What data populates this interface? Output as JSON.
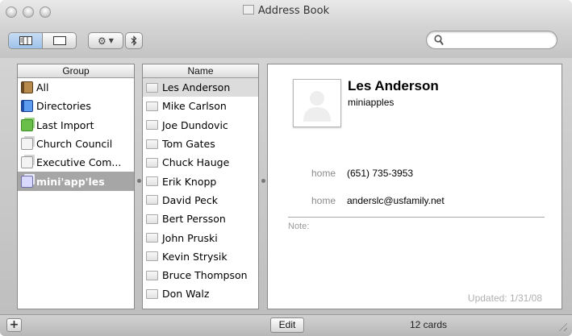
{
  "window": {
    "title": "Address Book"
  },
  "toolbar": {
    "view_buttons": [
      "columns-view",
      "card-only-view"
    ],
    "action_icon": "gear-icon",
    "bluetooth_icon": "bluetooth-icon",
    "search_placeholder": "",
    "search_icon": "magnifier-icon"
  },
  "groups": {
    "header": "Group",
    "items": [
      {
        "label": "All",
        "icon": "address-book-icon",
        "selected": false
      },
      {
        "label": "Directories",
        "icon": "directory-icon",
        "selected": false
      },
      {
        "label": "Last Import",
        "icon": "group-icon",
        "selected": false
      },
      {
        "label": "Church Council",
        "icon": "group-icon",
        "selected": false
      },
      {
        "label": "Executive Com...",
        "icon": "group-icon",
        "selected": false
      },
      {
        "label": "mini'app'les",
        "icon": "smart-group-icon",
        "selected": true
      }
    ]
  },
  "names": {
    "header": "Name",
    "items": [
      {
        "label": "Les Anderson",
        "selected": true
      },
      {
        "label": "Mike Carlson",
        "selected": false
      },
      {
        "label": "Joe Dundovic",
        "selected": false
      },
      {
        "label": "Tom Gates",
        "selected": false
      },
      {
        "label": "Chuck Hauge",
        "selected": false
      },
      {
        "label": "Erik Knopp",
        "selected": false
      },
      {
        "label": "David Peck",
        "selected": false
      },
      {
        "label": "Bert Persson",
        "selected": false
      },
      {
        "label": "John Pruski",
        "selected": false
      },
      {
        "label": "Kevin Strysik",
        "selected": false
      },
      {
        "label": "Bruce Thompson",
        "selected": false
      },
      {
        "label": "Don Walz",
        "selected": false
      }
    ]
  },
  "card": {
    "name": "Les Anderson",
    "company": "miniapples",
    "fields": [
      {
        "label": "home",
        "value": "(651) 735-3953"
      },
      {
        "label": "home",
        "value": "anderslc@usfamily.net"
      }
    ],
    "note_label": "Note:",
    "updated": "Updated: 1/31/08"
  },
  "bottom": {
    "add_label": "+",
    "edit_label": "Edit",
    "card_count": "12 cards"
  },
  "colors": {
    "selected_group_bg": "#a6a6a6",
    "selected_name_bg": "#dcdcdc",
    "view_button_active": "#9ec2ea"
  }
}
